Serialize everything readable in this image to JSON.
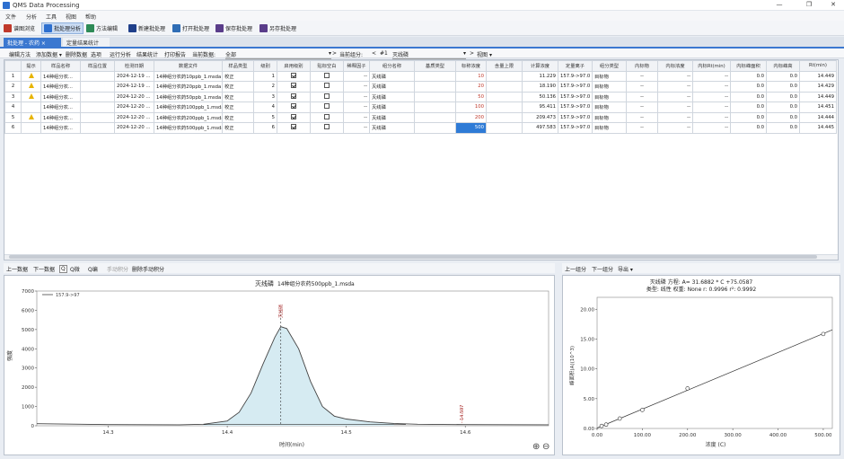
{
  "app": {
    "title": "QMS Data Processing",
    "min": "—",
    "max": "❐",
    "close": "✕"
  },
  "menu": [
    "文件",
    "分析",
    "工具",
    "视图",
    "帮助"
  ],
  "toolbar": [
    "谱图浏览",
    "批处理分析",
    "方法编辑",
    "新建批处理",
    "打开批处理",
    "保存批处理",
    "另存批处理"
  ],
  "doc_tabs": {
    "active": "批处理 - 农药",
    "active_close": "×",
    "other": "定量结果统计"
  },
  "subtoolbar": {
    "items": [
      "编辑方法",
      "添加数据 ▾",
      "删除数据",
      "选项",
      "运行分析",
      "结果统计",
      "打印报告",
      "当前数据:"
    ],
    "current_data_value": "全部",
    "current_component_label": "当前组分:",
    "nav_prev": "<",
    "nav_next": ">",
    "component_index": "#1",
    "component_name": "灭线磷",
    "view_label": "视图"
  },
  "table": {
    "headers": [
      "",
      "提示",
      "样品名称",
      "样品位置",
      "检测日期",
      "数据文件",
      "样品类型",
      "级别",
      "启用级别",
      "贴标空白",
      "稀释因子",
      "组分名称",
      "基质类型",
      "标称浓度",
      "含量上限",
      "计算浓度",
      "定量离子",
      "组分类型",
      "内标物",
      "内标浓度",
      "内标Rt(min)",
      "内标峰面积",
      "内标峰高",
      "Rt(min)"
    ],
    "rows": [
      {
        "idx": "1",
        "warn": true,
        "name": "14种组分农...",
        "pos": "",
        "date": "2024-12-19 ...",
        "file": "14种组分农药10ppb_1.msda",
        "type": "校正",
        "level": "1",
        "enabled": true,
        "blank": false,
        "dil": "--",
        "comp": "灭线磷",
        "matrix": "",
        "nominal": "10",
        "upper": "",
        "calc": "11.229",
        "ion": "157.9->97.0",
        "ctype": "目标物",
        "is": "--",
        "isconc": "--",
        "isrt": "--",
        "isarea": "0.0",
        "isheight": "0.0",
        "rt": "14.449"
      },
      {
        "idx": "2",
        "warn": true,
        "name": "14种组分农...",
        "pos": "",
        "date": "2024-12-19 ...",
        "file": "14种组分农药20ppb_1.msda",
        "type": "校正",
        "level": "2",
        "enabled": true,
        "blank": false,
        "dil": "--",
        "comp": "灭线磷",
        "matrix": "",
        "nominal": "20",
        "upper": "",
        "calc": "18.190",
        "ion": "157.9->97.0",
        "ctype": "目标物",
        "is": "--",
        "isconc": "--",
        "isrt": "--",
        "isarea": "0.0",
        "isheight": "0.0",
        "rt": "14.429"
      },
      {
        "idx": "3",
        "warn": true,
        "name": "14种组分农...",
        "pos": "",
        "date": "2024-12-20 ...",
        "file": "14种组分农药50ppb_1.msda",
        "type": "校正",
        "level": "3",
        "enabled": true,
        "blank": false,
        "dil": "--",
        "comp": "灭线磷",
        "matrix": "",
        "nominal": "50",
        "upper": "",
        "calc": "50.136",
        "ion": "157.9->97.0",
        "ctype": "目标物",
        "is": "--",
        "isconc": "--",
        "isrt": "--",
        "isarea": "0.0",
        "isheight": "0.0",
        "rt": "14.449"
      },
      {
        "idx": "4",
        "warn": false,
        "name": "14种组分农...",
        "pos": "",
        "date": "2024-12-20 ...",
        "file": "14种组分农药100ppb_1.msda",
        "type": "校正",
        "level": "4",
        "enabled": true,
        "blank": false,
        "dil": "--",
        "comp": "灭线磷",
        "matrix": "",
        "nominal": "100",
        "upper": "",
        "calc": "95.411",
        "ion": "157.9->97.0",
        "ctype": "目标物",
        "is": "--",
        "isconc": "--",
        "isrt": "--",
        "isarea": "0.0",
        "isheight": "0.0",
        "rt": "14.451"
      },
      {
        "idx": "5",
        "warn": true,
        "name": "14种组分农...",
        "pos": "",
        "date": "2024-12-20 ...",
        "file": "14种组分农药200ppb_1.msda",
        "type": "校正",
        "level": "5",
        "enabled": true,
        "blank": false,
        "dil": "--",
        "comp": "灭线磷",
        "matrix": "",
        "nominal": "200",
        "upper": "",
        "calc": "209.473",
        "ion": "157.9->97.0",
        "ctype": "目标物",
        "is": "--",
        "isconc": "--",
        "isrt": "--",
        "isarea": "0.0",
        "isheight": "0.0",
        "rt": "14.444"
      },
      {
        "idx": "6",
        "warn": false,
        "name": "14种组分农...",
        "pos": "",
        "date": "2024-12-20 ...",
        "file": "14种组分农药500ppb_1.msda",
        "type": "校正",
        "level": "6",
        "enabled": true,
        "blank": false,
        "dil": "--",
        "comp": "灭线磷",
        "matrix": "",
        "nominal": "500",
        "upper": "",
        "calc": "497.583",
        "ion": "157.9->97.0",
        "ctype": "目标物",
        "is": "--",
        "isconc": "--",
        "isrt": "--",
        "isarea": "0.0",
        "isheight": "0.0",
        "rt": "14.445"
      }
    ]
  },
  "left_bar": {
    "items": [
      "上一数据",
      "下一数据",
      "Q",
      "Q微",
      "Q编",
      "手动积分",
      "删除手动积分"
    ]
  },
  "right_bar": {
    "items": [
      "上一组分",
      "下一组分",
      "导出 ▾"
    ]
  },
  "chromatogram": {
    "title": "灭线磷",
    "file": "14种组分农药500ppb_1.msda",
    "legend": "157.9->97",
    "ylabel": "强度",
    "xlabel": "时间(min)",
    "peak_label": "灭线磷",
    "peak2_label": "14.597",
    "zoom_in": "⊕",
    "zoom_out": "⊖"
  },
  "calibration": {
    "header1": "灭线磷  方程:  A= 31.6882 * C +75.0587",
    "header2": "类型: 线性  权重: None  r: 0.9996  r²: 0.9992",
    "ylabel": "峰面积(A)(10^3)",
    "xlabel": "浓度 (C)"
  },
  "chart_data": [
    {
      "type": "area",
      "title": "灭线磷",
      "subtitle": "14种组分农药500ppb_1.msda",
      "xlabel": "时间(min)",
      "ylabel": "强度",
      "xlim": [
        14.24,
        14.67
      ],
      "ylim": [
        0,
        7000
      ],
      "xticks": [
        14.3,
        14.4,
        14.5,
        14.6
      ],
      "yticks": [
        0,
        1000,
        2000,
        3000,
        4000,
        5000,
        6000,
        7000
      ],
      "series": [
        {
          "name": "157.9->97",
          "x": [
            14.24,
            14.3,
            14.36,
            14.38,
            14.4,
            14.41,
            14.42,
            14.43,
            14.44,
            14.445,
            14.45,
            14.46,
            14.47,
            14.48,
            14.49,
            14.5,
            14.52,
            14.54,
            14.56,
            14.6,
            14.67
          ],
          "y": [
            110,
            60,
            50,
            80,
            250,
            700,
            1700,
            3200,
            4600,
            5150,
            5050,
            4000,
            2300,
            1000,
            500,
            350,
            200,
            120,
            80,
            60,
            50
          ]
        }
      ],
      "fill_region": [
        14.38,
        14.55
      ],
      "annotations": [
        {
          "x": 14.445,
          "label": "灭线磷"
        },
        {
          "x": 14.597,
          "label": "14.597"
        }
      ]
    },
    {
      "type": "scatter",
      "xlabel": "浓度 (C)",
      "ylabel": "峰面积(A)(10^3)",
      "xlim": [
        0,
        520
      ],
      "ylim": [
        0,
        22
      ],
      "xticks": [
        0,
        100,
        200,
        300,
        400,
        500
      ],
      "yticks": [
        0,
        5,
        10,
        15,
        20
      ],
      "points": {
        "x": [
          10,
          20,
          50,
          100,
          200,
          500
        ],
        "y": [
          0.43,
          0.65,
          1.66,
          3.1,
          6.71,
          15.84
        ]
      },
      "fit": {
        "slope": 0.0316882,
        "intercept": 0.0750587
      }
    }
  ]
}
